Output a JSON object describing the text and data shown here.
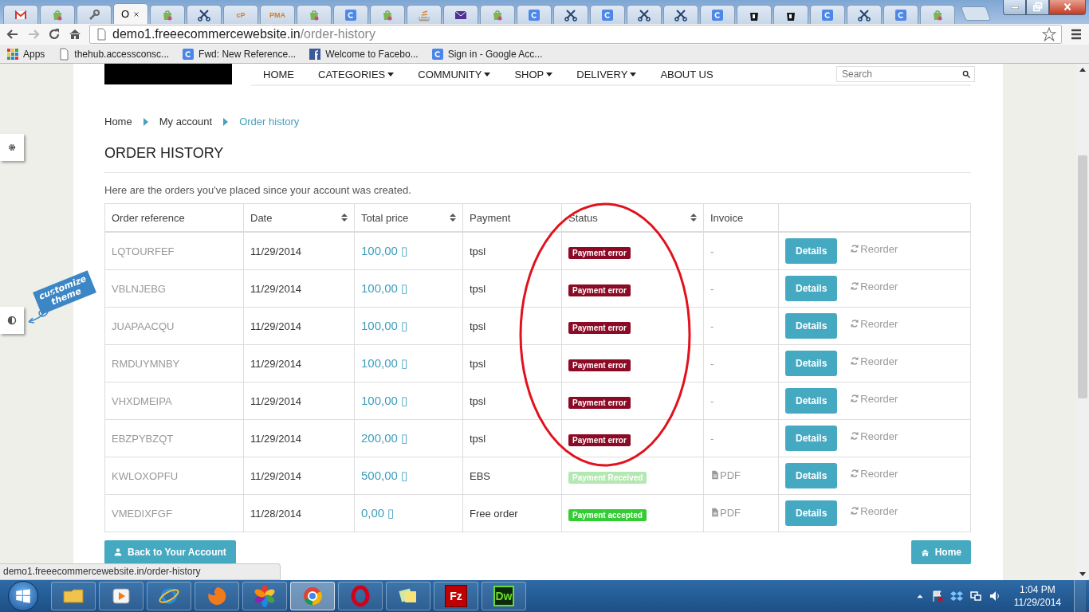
{
  "browser": {
    "tabs": [
      {
        "kind": "mail",
        "selected": false
      },
      {
        "kind": "bag",
        "selected": false
      },
      {
        "kind": "wrench",
        "selected": false
      },
      {
        "kind": "blank",
        "title": "O",
        "selected": true
      },
      {
        "kind": "bag",
        "selected": false
      },
      {
        "kind": "scissors",
        "selected": false
      },
      {
        "kind": "text",
        "icon_text": "cP",
        "selected": false
      },
      {
        "kind": "text",
        "icon_text": "PMA",
        "selected": false
      },
      {
        "kind": "bag",
        "selected": false
      },
      {
        "kind": "google",
        "selected": false
      },
      {
        "kind": "bag",
        "selected": false
      },
      {
        "kind": "stack",
        "selected": false
      },
      {
        "kind": "envelope",
        "selected": false
      },
      {
        "kind": "bag",
        "selected": false
      },
      {
        "kind": "google",
        "selected": false
      },
      {
        "kind": "scissors",
        "selected": false
      },
      {
        "kind": "google",
        "selected": false
      },
      {
        "kind": "scissors",
        "selected": false
      },
      {
        "kind": "scissors",
        "selected": false
      },
      {
        "kind": "google",
        "selected": false
      },
      {
        "kind": "blackbag",
        "selected": false
      },
      {
        "kind": "blackbag",
        "selected": false
      },
      {
        "kind": "google",
        "selected": false
      },
      {
        "kind": "scissors",
        "selected": false
      },
      {
        "kind": "google",
        "selected": false
      },
      {
        "kind": "bag",
        "selected": false
      }
    ],
    "address": {
      "host": "demo1.freeecommercewebsite.in",
      "path": "/order-history"
    },
    "bookmarks": [
      {
        "kind": "apps",
        "label": "Apps"
      },
      {
        "kind": "page",
        "label": "thehub.accessconsc..."
      },
      {
        "kind": "google",
        "label": "Fwd: New Reference..."
      },
      {
        "kind": "facebook",
        "label": "Welcome to Facebo..."
      },
      {
        "kind": "google",
        "label": "Sign in - Google Acc..."
      }
    ]
  },
  "site": {
    "nav": [
      "HOME",
      "CATEGORIES",
      "COMMUNITY",
      "SHOP",
      "DELIVERY",
      "ABOUT US"
    ],
    "nav_dropdown": [
      false,
      true,
      true,
      true,
      true,
      false
    ],
    "search": {
      "placeholder": "Search"
    },
    "theme_widget": {
      "label": "customize theme"
    },
    "breadcrumb": [
      {
        "label": "Home",
        "current": false
      },
      {
        "label": "My account",
        "current": false
      },
      {
        "label": "Order history",
        "current": true
      }
    ],
    "title": "ORDER HISTORY",
    "intro": "Here are the orders you've placed since your account was created.",
    "table": {
      "columns": [
        {
          "label": "Order reference",
          "sortable": false
        },
        {
          "label": "Date",
          "sortable": true
        },
        {
          "label": "Total price",
          "sortable": true
        },
        {
          "label": "Payment",
          "sortable": false
        },
        {
          "label": "Status",
          "sortable": true
        },
        {
          "label": "Invoice",
          "sortable": false
        }
      ],
      "rows": [
        {
          "reference": "LQTOURFEF",
          "date": "11/29/2014",
          "total": "100,00 ▯",
          "payment": "tpsl",
          "status": {
            "label": "Payment error",
            "color": "#8b0a25"
          },
          "invoice": {
            "kind": "none",
            "label": "-"
          },
          "details": "Details",
          "reorder": "Reorder"
        },
        {
          "reference": "VBLNJEBG",
          "date": "11/29/2014",
          "total": "100,00 ▯",
          "payment": "tpsl",
          "status": {
            "label": "Payment error",
            "color": "#8b0a25"
          },
          "invoice": {
            "kind": "none",
            "label": "-"
          },
          "details": "Details",
          "reorder": "Reorder"
        },
        {
          "reference": "JUAPAACQU",
          "date": "11/29/2014",
          "total": "100,00 ▯",
          "payment": "tpsl",
          "status": {
            "label": "Payment error",
            "color": "#8b0a25"
          },
          "invoice": {
            "kind": "none",
            "label": "-"
          },
          "details": "Details",
          "reorder": "Reorder"
        },
        {
          "reference": "RMDUYMNBY",
          "date": "11/29/2014",
          "total": "100,00 ▯",
          "payment": "tpsl",
          "status": {
            "label": "Payment error",
            "color": "#8b0a25"
          },
          "invoice": {
            "kind": "none",
            "label": "-"
          },
          "details": "Details",
          "reorder": "Reorder"
        },
        {
          "reference": "VHXDMEIPA",
          "date": "11/29/2014",
          "total": "100,00 ▯",
          "payment": "tpsl",
          "status": {
            "label": "Payment error",
            "color": "#8b0a25"
          },
          "invoice": {
            "kind": "none",
            "label": "-"
          },
          "details": "Details",
          "reorder": "Reorder"
        },
        {
          "reference": "EBZPYBZQT",
          "date": "11/29/2014",
          "total": "200,00 ▯",
          "payment": "tpsl",
          "status": {
            "label": "Payment error",
            "color": "#8b0a25"
          },
          "invoice": {
            "kind": "none",
            "label": "-"
          },
          "details": "Details",
          "reorder": "Reorder"
        },
        {
          "reference": "KWLOXOPFU",
          "date": "11/29/2014",
          "total": "500,00 ▯",
          "payment": "EBS",
          "status": {
            "label": "Payment Received",
            "color": "#b4e8b2"
          },
          "invoice": {
            "kind": "pdf",
            "label": "PDF"
          },
          "details": "Details",
          "reorder": "Reorder"
        },
        {
          "reference": "VMEDIXFGF",
          "date": "11/28/2014",
          "total": "0,00 ▯",
          "payment": "Free order",
          "status": {
            "label": "Payment accepted",
            "color": "#32cd32"
          },
          "invoice": {
            "kind": "pdf",
            "label": "PDF"
          },
          "details": "Details",
          "reorder": "Reorder"
        }
      ]
    },
    "buttons": {
      "back": "Back to Your Account",
      "home": "Home"
    }
  },
  "status_url": "demo1.freeecommercewebsite.in/order-history",
  "taskbar": {
    "apps": [
      {
        "kind": "explorer",
        "selected": false
      },
      {
        "kind": "media",
        "selected": false
      },
      {
        "kind": "ie",
        "selected": false
      },
      {
        "kind": "firefox",
        "selected": false
      },
      {
        "kind": "flower",
        "selected": false
      },
      {
        "kind": "chrome",
        "selected": true
      },
      {
        "kind": "opera",
        "selected": false
      },
      {
        "kind": "notes",
        "selected": false
      },
      {
        "kind": "filezilla",
        "label": "Fz",
        "selected": false
      },
      {
        "kind": "dreamweaver",
        "label": "Dw",
        "selected": false
      }
    ],
    "clock": {
      "time": "1:04 PM",
      "date": "11/29/2014"
    }
  }
}
